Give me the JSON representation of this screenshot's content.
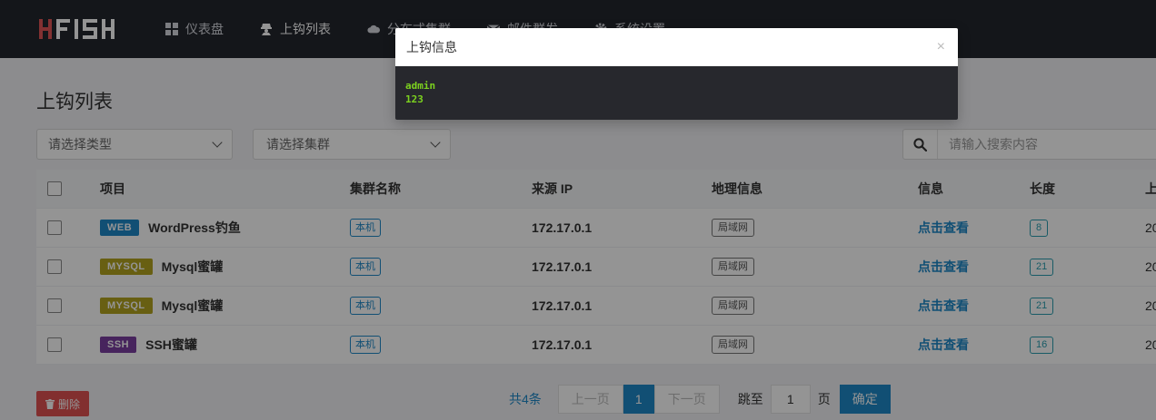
{
  "nav": {
    "logo_text": "HFISH",
    "items": [
      {
        "label": "仪表盘",
        "icon": "dashboard-icon"
      },
      {
        "label": "上钩列表",
        "icon": "hacker-icon"
      },
      {
        "label": "分布式集群",
        "icon": "cloud-icon"
      },
      {
        "label": "邮件群发",
        "icon": "mail-icon"
      },
      {
        "label": "系统设置",
        "icon": "gear-icon"
      }
    ]
  },
  "page": {
    "title": "上钩列表",
    "type_select": "请选择类型",
    "cluster_select": "请选择集群",
    "search_placeholder": "请输入搜索内容"
  },
  "table": {
    "headers": [
      "项目",
      "集群名称",
      "来源 IP",
      "地理信息",
      "信息",
      "长度",
      "上"
    ],
    "rows": [
      {
        "tag": "WEB",
        "tag_color": "#1e88c8",
        "project": "WordPress钓鱼",
        "cluster": "本机",
        "ip": "172.17.0.1",
        "geo": "局域网",
        "info": "点击查看",
        "length": "8",
        "time": "20"
      },
      {
        "tag": "MYSQL",
        "tag_color": "#b3a41f",
        "project": "Mysql蜜罐",
        "cluster": "本机",
        "ip": "172.17.0.1",
        "geo": "局域网",
        "info": "点击查看",
        "length": "21",
        "time": "20"
      },
      {
        "tag": "MYSQL",
        "tag_color": "#b3a41f",
        "project": "Mysql蜜罐",
        "cluster": "本机",
        "ip": "172.17.0.1",
        "geo": "局域网",
        "info": "点击查看",
        "length": "21",
        "time": "20"
      },
      {
        "tag": "SSH",
        "tag_color": "#7b3fa0",
        "project": "SSH蜜罐",
        "cluster": "本机",
        "ip": "172.17.0.1",
        "geo": "局域网",
        "info": "点击查看",
        "length": "16",
        "time": "20"
      }
    ]
  },
  "footer": {
    "delete_label": "删除",
    "total": "共4条",
    "prev": "上一页",
    "current_page": "1",
    "next": "下一页",
    "goto_label": "跳至",
    "goto_value": "1",
    "page_unit": "页",
    "confirm": "确定"
  },
  "modal": {
    "title": "上钩信息",
    "close": "×",
    "lines": [
      "admin",
      "123"
    ]
  }
}
